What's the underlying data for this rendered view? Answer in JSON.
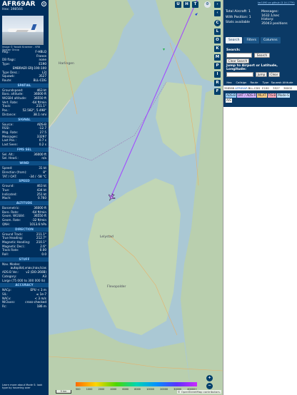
{
  "infoblock": {
    "callsign": "AFR69AR",
    "hex_label": "Hex:",
    "hex": "398566",
    "photo_credit": "Image © Yanaik Kraemer - VRB Spotter Group",
    "top_rows": [
      {
        "label": "Reg.:",
        "value": "F-HBLQ"
      },
      {
        "label": "",
        "value": "France"
      },
      {
        "label": "DB flags:",
        "value": "none"
      },
      {
        "label": "Type:",
        "value": "E190"
      },
      {
        "label": "",
        "value": "EMBRAER ERJ-190-100"
      },
      {
        "label": "Type Desc.:",
        "value": "L2J"
      },
      {
        "label": "Squawk:",
        "value": "3527"
      },
      {
        "label": "Route:",
        "value": "BLL-CDG"
      }
    ],
    "sections": [
      {
        "title": "SPATIAL",
        "rows": [
          {
            "label": "Groundspeed:",
            "value": "463 kt"
          },
          {
            "label": "Baro. altitude:",
            "value": "36000 ft"
          },
          {
            "label": "WGS84 altitude:",
            "value": "36550 ft"
          },
          {
            "label": "Vert. Rate:",
            "value": "-64 ft/min"
          },
          {
            "label": "Track:",
            "value": "211.1°"
          },
          {
            "label": "Pos.:",
            "value": "52.582°, 5.498°"
          },
          {
            "label": "Distance:",
            "value": "38.1 nmi"
          }
        ]
      },
      {
        "title": "SIGNAL",
        "rows": [
          {
            "label": "Source:",
            "value": "ADS-B"
          },
          {
            "label": "RSSI:",
            "value": "-12.7"
          },
          {
            "label": "Msg. Rate:",
            "value": "27.5"
          },
          {
            "label": "Messages:",
            "value": "33297"
          },
          {
            "label": "Last Pos.:",
            "value": "0.7 s"
          },
          {
            "label": "Last Seen:",
            "value": "0.2 s"
          }
        ]
      },
      {
        "title": "FMS SEL",
        "rows": [
          {
            "label": "Sel. Alt.:",
            "value": "36000 ft"
          },
          {
            "label": "Sel. Head.:",
            "value": "n/a"
          }
        ]
      },
      {
        "title": "WIND",
        "rows": [
          {
            "label": "Speed:",
            "value": "31 kt"
          },
          {
            "label": "Direction (from):",
            "value": "8°"
          },
          {
            "label": "TAT / OAT:",
            "value": "-34 / -58 °C"
          }
        ]
      },
      {
        "title": "SPEED",
        "rows": [
          {
            "label": "Ground:",
            "value": "463 kt"
          },
          {
            "label": "True:",
            "value": "434 kt"
          },
          {
            "label": "Indicated:",
            "value": "251 kt"
          },
          {
            "label": "Mach:",
            "value": "0.760"
          }
        ]
      },
      {
        "title": "ALTITUDE",
        "rows": [
          {
            "label": "Barometric:",
            "value": "36000 ft"
          },
          {
            "label": "Baro. Rate:",
            "value": "-64 ft/min"
          },
          {
            "label": "Geom. WGS84:",
            "value": "36550 ft"
          },
          {
            "label": "Geom. Rate:",
            "value": "-32 ft/min"
          },
          {
            "label": "QNH:",
            "value": "1013.6 hPa"
          }
        ]
      },
      {
        "title": "DIRECTION",
        "rows": [
          {
            "label": "Ground Track:",
            "value": "211.1°"
          },
          {
            "label": "True Heading:",
            "value": "212.7°"
          },
          {
            "label": "Magnetic Heading:",
            "value": "210.1°"
          },
          {
            "label": "Magnetic Decl.:",
            "value": "2.6°"
          },
          {
            "label": "Track Rate:",
            "value": "0.00"
          },
          {
            "label": "Roll:",
            "value": "0.0"
          }
        ]
      },
      {
        "title": "STUFF",
        "rows": [
          {
            "label": "Nav. Modes:",
            "value": ""
          },
          {
            "label": "",
            "value": "autopilot,vnav,lnav,tcas"
          },
          {
            "label": "ADS-B Ver.:",
            "value": "v2 (DO-260B)"
          },
          {
            "label": "Category:",
            "value": "A3"
          },
          {
            "label": "Large (75 000 to 300 000 lb)",
            "value": ""
          }
        ]
      },
      {
        "title": "ACCURACY",
        "rows": [
          {
            "label": "NACp:",
            "value": "EPU < 3 m"
          },
          {
            "label": "SIL:",
            "value": "≤ 1e-7"
          },
          {
            "label": "NACv:",
            "value": "< 3 m/s"
          },
          {
            "label": "NICbaro:",
            "value": "cross-checked"
          },
          {
            "label": "Rc:",
            "value": "186 m"
          }
        ]
      }
    ],
    "footer": "Learn more about Mode S: look type by hovering over"
  },
  "map": {
    "labels": [
      {
        "name": "Harlingen",
        "text": "Harlingen"
      },
      {
        "name": "Lelystad",
        "text": "Lelystad"
      },
      {
        "name": "Flevopolder",
        "text": "Flevopolder"
      }
    ],
    "top_buttons": [
      "U",
      "H",
      "T"
    ],
    "side_buttons": [
      "C",
      "L",
      "O",
      "K",
      "M",
      "P",
      "I",
      "R",
      "F"
    ],
    "zoom_in": "+",
    "zoom_out": "−",
    "scale": "5 km",
    "attribution": "© OpenStreetMap contributors.",
    "altitude_ticks": [
      "500",
      "1000",
      "2000",
      "4000",
      "6000",
      "8000",
      "10000",
      "20000",
      "30000",
      "40000+"
    ],
    "track_color": "#a24cff",
    "water_color": "#aac8d4",
    "land_color": "#b9cfae"
  },
  "sidebar": {
    "link": "tar1090 on github (3.14.1779)",
    "total_label": "Total Aircraft:",
    "total": "1",
    "position_label": "With Position:",
    "position": "1",
    "stats_label": "Stats available",
    "messages_label": "Messages:",
    "messages": "1632.1/sec",
    "history_label": "History:",
    "history": "35043 positions",
    "tabs": [
      "Search",
      "Filters",
      "Columns"
    ],
    "search_label": "Search:",
    "search_button": "Search",
    "clear_search": "Clear Search",
    "jump_label": "Jump to Airport or Latitude, Longitude:",
    "jump_button": "Jump",
    "clear_button": "Clear",
    "columns": [
      "Hex",
      "Callsign",
      "Route",
      "Type",
      "Squawk",
      "Altitude"
    ],
    "row": [
      "398566",
      "AFR69AR",
      "BLL-CDG",
      "E190",
      "3527",
      "36000"
    ],
    "legend": [
      {
        "text": "ADS-B",
        "color": "#9fd3ff"
      },
      {
        "text": "UAT / ADS-R",
        "color": "#d6b3ff"
      },
      {
        "text": "MLAT",
        "color": "#ffd089"
      },
      {
        "text": "TIS-B",
        "color": "#ffadbf"
      },
      {
        "text": "Mode-S",
        "color": "#c7e7ff"
      },
      {
        "text": "AIS",
        "color": "#ffffff"
      }
    ]
  }
}
